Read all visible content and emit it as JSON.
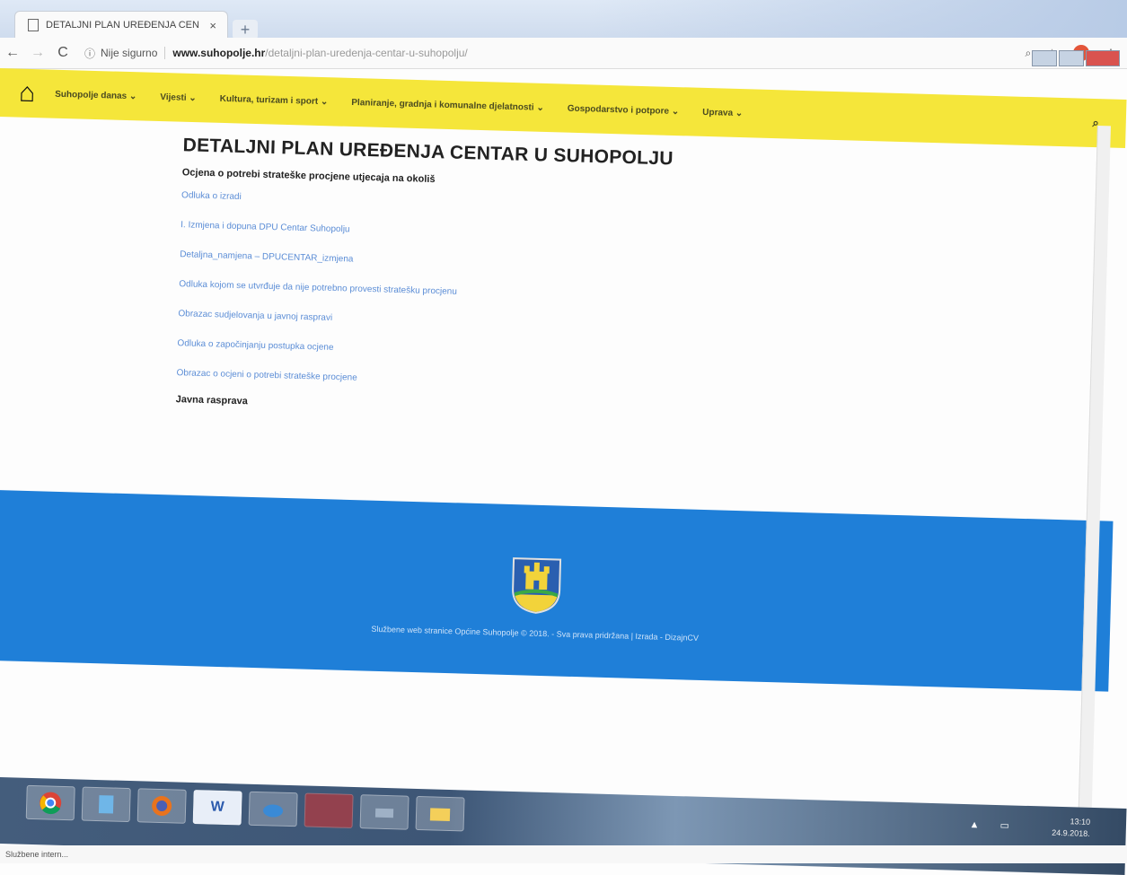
{
  "browser": {
    "tab_title": "DETALJNI PLAN UREĐENJA CEN",
    "tab_close": "×",
    "new_tab": "+",
    "back": "←",
    "forward": "→",
    "reload": "C",
    "security_icon": "ⓘ",
    "security_label": "Nije sigurno",
    "url_host": "www.suhopolje.hr",
    "url_path": "/detaljni-plan-uredenja-centar-u-suhopolju/",
    "search_icon": "⌕",
    "star_icon": "☆",
    "menu_icon": "⋮"
  },
  "site_nav": {
    "home_icon": "⌂",
    "items": [
      "Suhopolje danas ⌄",
      "Vijesti ⌄",
      "Kultura, turizam i sport ⌄",
      "Planiranje, gradnja i komunalne djelatnosti ⌄",
      "Gospodarstvo i potpore ⌄",
      "Uprava ⌄"
    ],
    "search_icon": "⌕"
  },
  "main": {
    "page_title": "DETALJNI PLAN UREĐENJA CENTAR U SUHOPOLJU",
    "section_title": "Ocjena o potrebi strateške procjene utjecaja na okoliš",
    "links": [
      "Odluka o izradi",
      "I. Izmjena i dopuna DPU Centar Suhopolju",
      "Detaljna_namjena – DPUCENTAR_izmjena",
      "Odluka kojom se utvrđuje da nije potrebno provesti stratešku procjenu",
      "Obrazac sudjelovanja u javnoj raspravi",
      "Odluka o započinjanju postupka ocjene",
      "Obrazac o ocjeni o potrebi strateške procjene"
    ],
    "bottom_section_title": "Javna rasprava"
  },
  "footer": {
    "text": "Službene web stranice Općine Suhopolje © 2018. - Sva prava pridržana | Izrada - DizajnCV"
  },
  "taskbar": {
    "apps": [
      "",
      "",
      "",
      "W",
      "",
      "",
      "",
      ""
    ],
    "tray": "▲ ▭",
    "time": "13:10",
    "date": "24.9.2018."
  },
  "status": {
    "text": "Službene intern..."
  },
  "colors": {
    "nav_yellow": "#f5e63a",
    "footer_blue": "#1f7fd8",
    "link_blue": "#5b8dd6"
  }
}
